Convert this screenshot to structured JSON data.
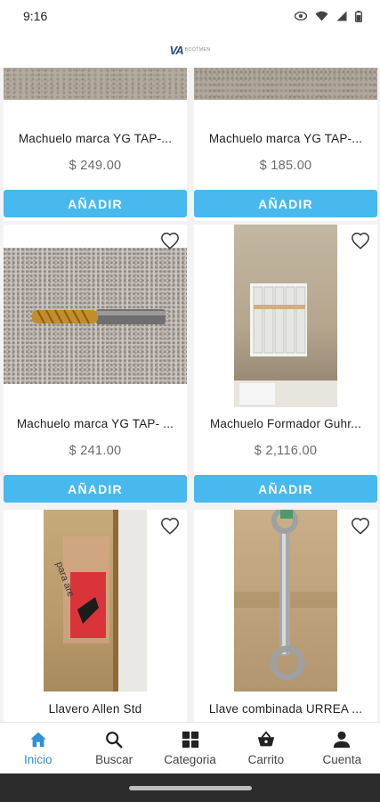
{
  "status_bar": {
    "time": "9:16"
  },
  "header": {
    "logo_mark": "VA",
    "logo_text": "BOOTMEN"
  },
  "products": [
    {
      "title": "Machuelo marca YG TAP-...",
      "price": "$ 249.00",
      "button": "AÑADIR"
    },
    {
      "title": "Machuelo marca YG TAP-...",
      "price": "$ 185.00",
      "button": "AÑADIR"
    },
    {
      "title": "Machuelo marca YG TAP- ...",
      "price": "$ 241.00",
      "button": "AÑADIR"
    },
    {
      "title": "Machuelo Formador Guhr...",
      "price": "$ 2,116.00",
      "button": "AÑADIR"
    },
    {
      "title": "Llavero Allen Std",
      "price": "",
      "button": ""
    },
    {
      "title": "Llave combinada URREA ...",
      "price": "",
      "button": ""
    }
  ],
  "bottom_nav": [
    {
      "label": "Inicio",
      "icon": "home-icon",
      "active": true
    },
    {
      "label": "Buscar",
      "icon": "search-icon",
      "active": false
    },
    {
      "label": "Categoria",
      "icon": "grid-icon",
      "active": false
    },
    {
      "label": "Carrito",
      "icon": "basket-icon",
      "active": false
    },
    {
      "label": "Cuenta",
      "icon": "person-icon",
      "active": false
    }
  ],
  "colors": {
    "accent": "#48b9ee",
    "active_nav": "#2f8fd9",
    "price": "#6b6b6b"
  }
}
